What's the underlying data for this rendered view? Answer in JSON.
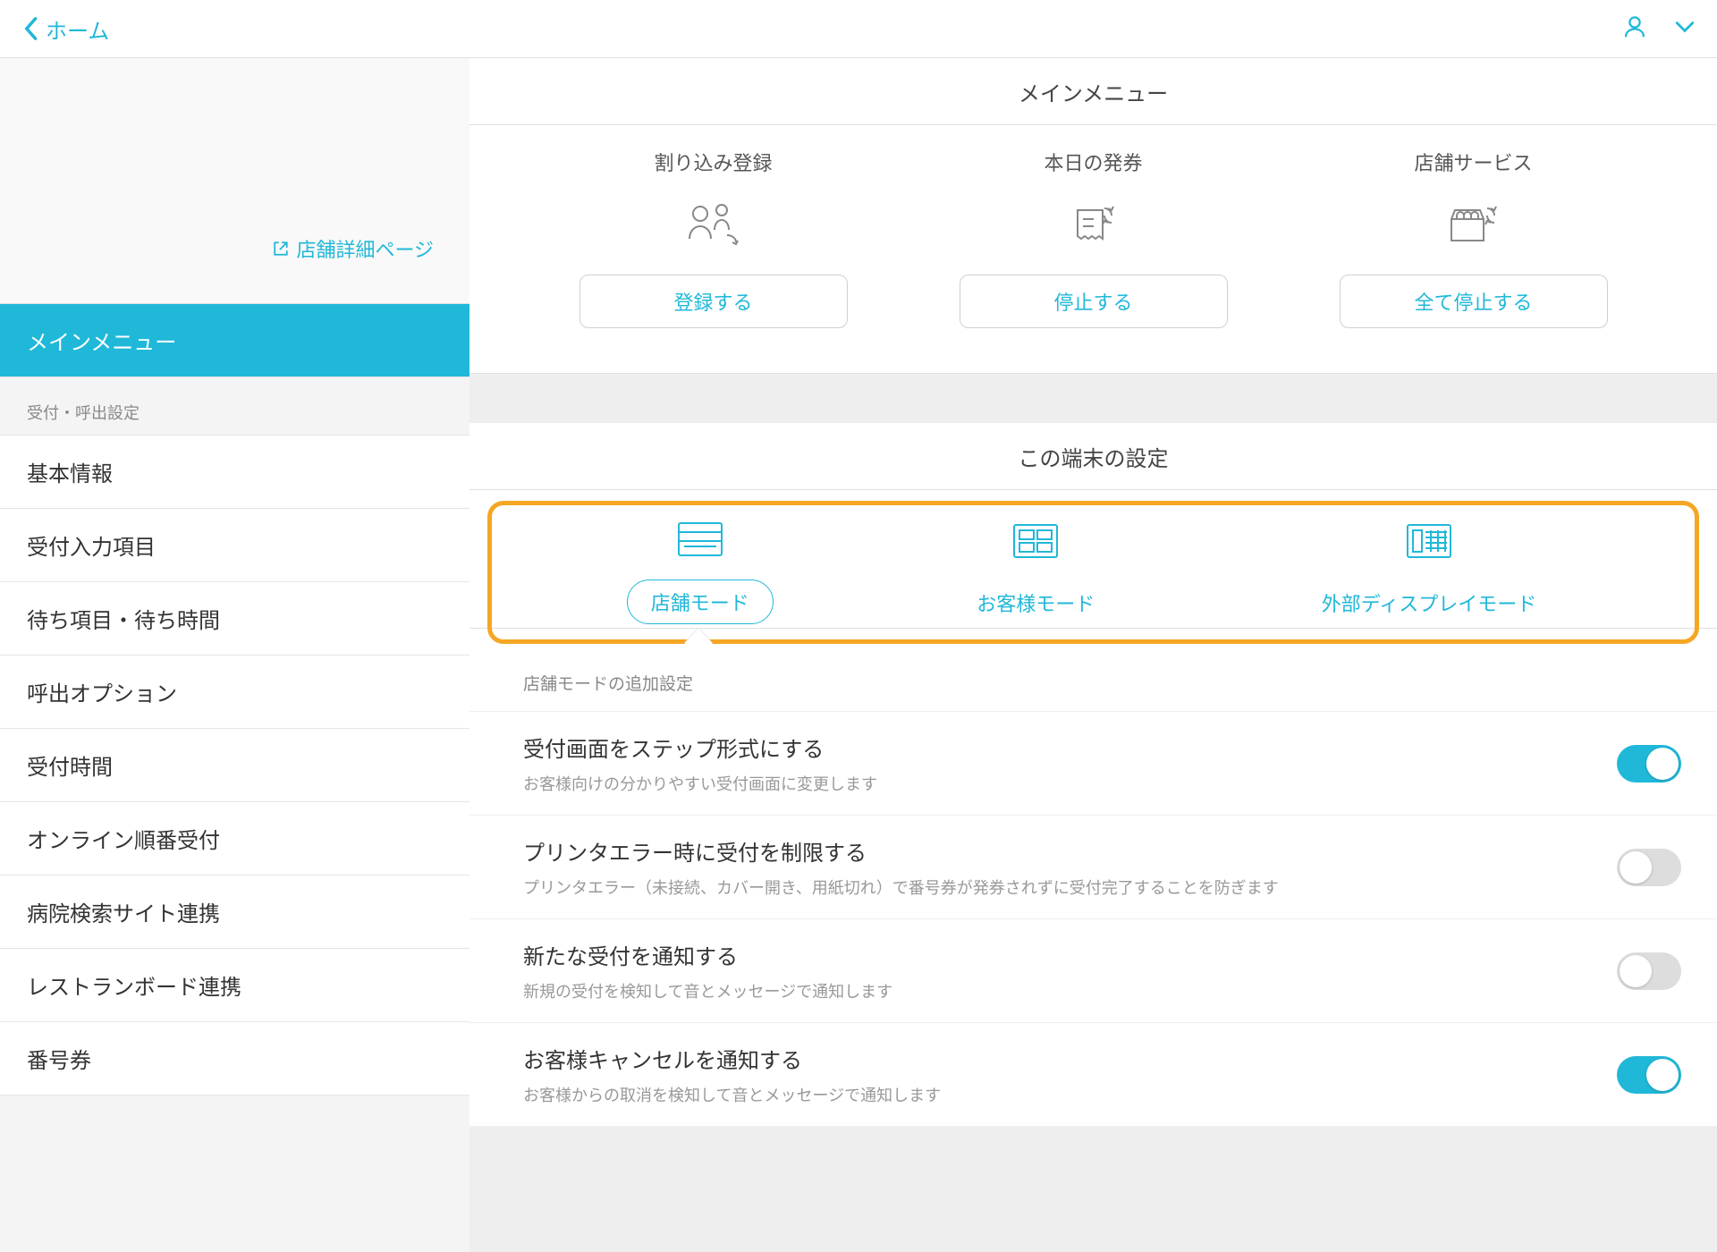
{
  "topbar": {
    "back": "ホーム"
  },
  "sidebar": {
    "store_link": "店舗詳細ページ",
    "main_menu": "メインメニュー",
    "section1": "受付・呼出設定",
    "items": [
      "基本情報",
      "受付入力項目",
      "待ち項目・待ち時間",
      "呼出オプション",
      "受付時間",
      "オンライン順番受付",
      "病院検索サイト連携",
      "レストランボード連携",
      "番号券"
    ]
  },
  "main_menu": {
    "title": "メインメニュー",
    "cards": [
      {
        "title": "割り込み登録",
        "button": "登録する"
      },
      {
        "title": "本日の発券",
        "button": "停止する"
      },
      {
        "title": "店舗サービス",
        "button": "全て停止する"
      }
    ]
  },
  "terminal": {
    "title": "この端末の設定",
    "modes": [
      "店舗モード",
      "お客様モード",
      "外部ディスプレイモード"
    ],
    "subsection": "店舗モードの追加設定",
    "settings": [
      {
        "title": "受付画面をステップ形式にする",
        "desc": "お客様向けの分かりやすい受付画面に変更します",
        "on": true
      },
      {
        "title": "プリンタエラー時に受付を制限する",
        "desc": "プリンタエラー（未接続、カバー開き、用紙切れ）で番号券が発券されずに受付完了することを防ぎます",
        "on": false
      },
      {
        "title": "新たな受付を通知する",
        "desc": "新規の受付を検知して音とメッセージで通知します",
        "on": false
      },
      {
        "title": "お客様キャンセルを通知する",
        "desc": "お客様からの取消を検知して音とメッセージで通知します",
        "on": true
      }
    ]
  }
}
